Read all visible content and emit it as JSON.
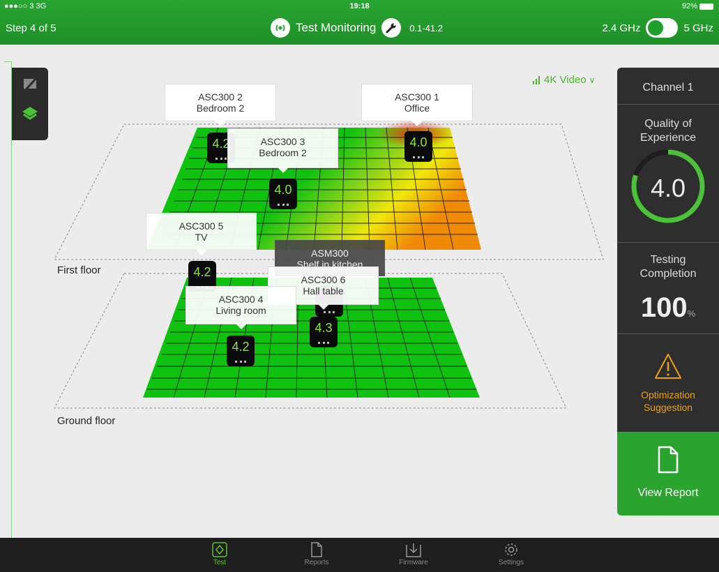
{
  "status": {
    "carrier": "●●●○○ 3  3G",
    "time": "19:18",
    "battery": "92%"
  },
  "header": {
    "step": "Step 4 of 5",
    "title": "Test Monitoring",
    "version": "0.1-41.2",
    "band_left": "2.4 GHz",
    "band_right": "5 GHz"
  },
  "video_filter": "4K Video",
  "floors": [
    {
      "label": "First floor"
    },
    {
      "label": "Ground floor"
    }
  ],
  "devices": [
    {
      "name": "ASC300 2",
      "room": "Bedroom 2",
      "score": "4.2"
    },
    {
      "name": "ASC300 1",
      "room": "Office",
      "score": "4.0"
    },
    {
      "name": "ASC300 3",
      "room": "Bedroom 2",
      "score": "4.0"
    },
    {
      "name": "ASC300 5",
      "room": "TV",
      "score": "4.2"
    },
    {
      "name": "ASM300",
      "room": "Shelf in kitchen",
      "score": ""
    },
    {
      "name": "ASC300 6",
      "room": "Hall table",
      "score": "4.3"
    },
    {
      "name": "ASC300 4",
      "room": "Living room",
      "score": "4.2"
    }
  ],
  "panel": {
    "channel": "Channel 1",
    "qoe_label_1": "Quality of",
    "qoe_label_2": "Experience",
    "qoe_value": "4.0",
    "qoe_fraction": 0.8,
    "tc_label_1": "Testing",
    "tc_label_2": "Completion",
    "tc_value": "100",
    "tc_unit": "%",
    "opt_1": "Optimization",
    "opt_2": "Suggestion",
    "report": "View Report"
  },
  "tabs": [
    {
      "label": "Test",
      "icon": "test-icon"
    },
    {
      "label": "Reports",
      "icon": "document-icon"
    },
    {
      "label": "Firmware",
      "icon": "download-icon"
    },
    {
      "label": "Settings",
      "icon": "gear-icon"
    }
  ],
  "colors": {
    "brand": "#29a531",
    "accent": "#5cc52f",
    "warning": "#e8a11f",
    "dark": "#2e2e2e"
  }
}
